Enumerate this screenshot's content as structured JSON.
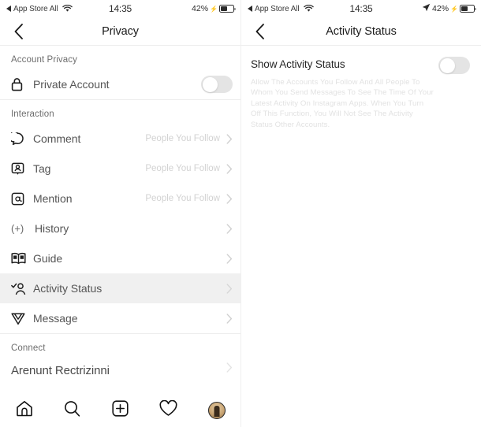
{
  "left": {
    "status_bar": {
      "carrier": "App Store All",
      "back_arrow_icon": "triangle-left-icon",
      "wifi_icon": "wifi-icon",
      "time": "14:35",
      "battery_percent": "42%",
      "charge_icon": "bolt-icon",
      "battery_icon": "battery-icon"
    },
    "navbar": {
      "back_icon": "chevron-left-icon",
      "title": "Privacy"
    },
    "sections": [
      {
        "header": "Account Privacy",
        "rows": [
          {
            "icon": "lock-icon",
            "label": "Private Account",
            "control": "toggle",
            "toggle_on": false
          }
        ]
      },
      {
        "header": "Interaction",
        "rows": [
          {
            "icon": "comment-bubble-icon",
            "label": "Comment",
            "value": "People You Follow",
            "control": "chevron"
          },
          {
            "icon": "tag-person-icon",
            "label": "Tag",
            "value": "People You Follow",
            "control": "chevron"
          },
          {
            "icon": "mention-at-icon",
            "label": "Mention",
            "value": "People You Follow",
            "control": "chevron"
          },
          {
            "icon": "plus-history-icon",
            "label": "History",
            "value": "",
            "control": "chevron"
          },
          {
            "icon": "guide-book-icon",
            "label": "Guide",
            "value": "",
            "control": "chevron"
          },
          {
            "icon": "activity-status-icon",
            "label": "Activity Status",
            "value": "",
            "control": "chevron",
            "highlighted": true
          },
          {
            "icon": "message-plane-icon",
            "label": "Message",
            "value": "",
            "control": "chevron"
          }
        ]
      },
      {
        "header": "Connect",
        "name_row": "Arenunt Rectrizinni"
      }
    ],
    "tabbar": [
      {
        "icon": "home-icon",
        "name": "home"
      },
      {
        "icon": "search-icon",
        "name": "search"
      },
      {
        "icon": "add-post-icon",
        "name": "add"
      },
      {
        "icon": "heart-icon",
        "name": "activity"
      },
      {
        "icon": "profile-avatar-icon",
        "name": "profile"
      }
    ]
  },
  "right": {
    "status_bar": {
      "carrier": "App Store All",
      "back_arrow_icon": "triangle-left-icon",
      "wifi_icon": "wifi-icon",
      "time": "14:35",
      "location_icon": "location-arrow-icon",
      "battery_percent": "42%",
      "charge_icon": "bolt-icon",
      "battery_icon": "battery-icon"
    },
    "navbar": {
      "back_icon": "chevron-left-icon",
      "title": "Activity Status"
    },
    "activity": {
      "title": "Show Activity Status",
      "toggle_on": false,
      "description": "Allow The Accounts You Follow And All People To Whom You Send Messages To See The Time Of Your Latest Activity On Instagram Apps. When You Turn Off This Function, You Will Not See The Activity Status Other Accounts."
    }
  },
  "colors": {
    "highlight_row": "#f0f0f0",
    "divider": "#ededed",
    "label_text": "#555555",
    "muted_text": "#d2d2d2",
    "toggle_track": "#e4e4e4"
  }
}
